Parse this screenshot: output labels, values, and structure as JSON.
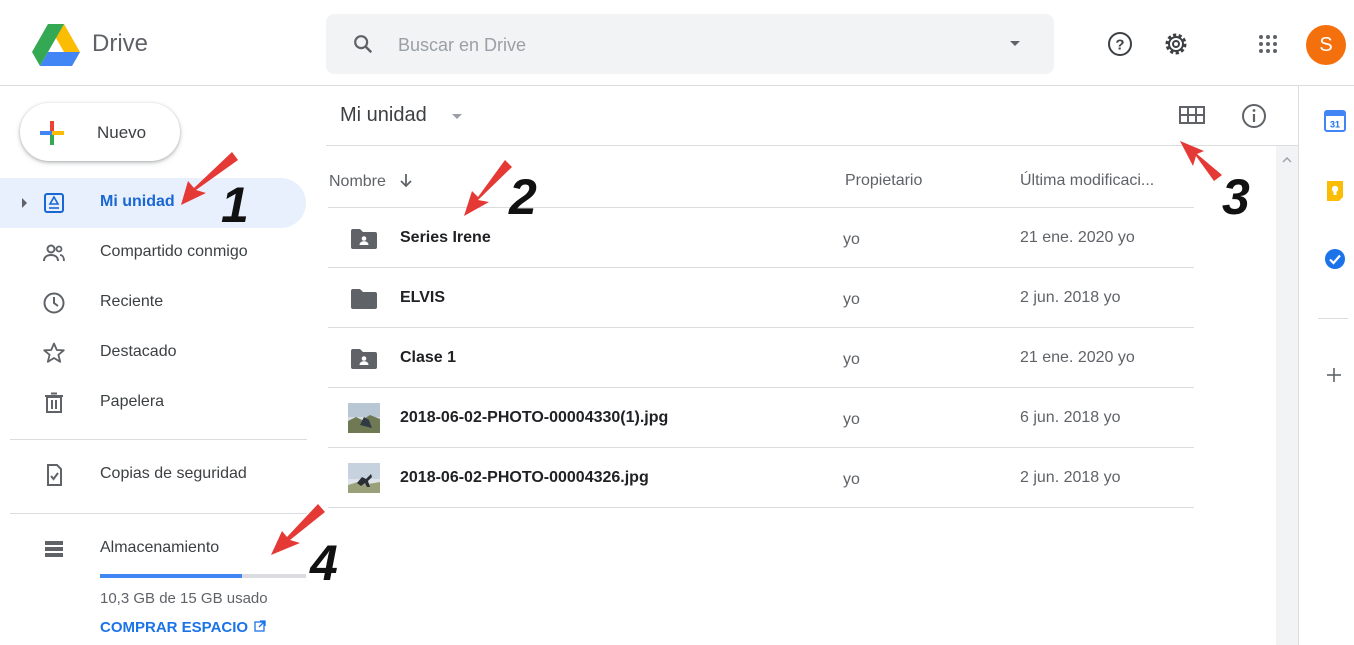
{
  "app": {
    "name": "Drive"
  },
  "search": {
    "placeholder": "Buscar en Drive"
  },
  "header": {
    "avatar_letter": "S",
    "avatar_color": "#f4700d",
    "icons": [
      "help-icon",
      "settings-icon",
      "apps-grid-icon"
    ]
  },
  "sidebar": {
    "new_label": "Nuevo",
    "items": [
      {
        "label": "Mi unidad",
        "icon": "my-drive-icon",
        "active": true
      },
      {
        "label": "Compartido conmigo",
        "icon": "shared-icon"
      },
      {
        "label": "Reciente",
        "icon": "clock-icon"
      },
      {
        "label": "Destacado",
        "icon": "star-icon"
      },
      {
        "label": "Papelera",
        "icon": "trash-icon"
      },
      {
        "label": "Copias de seguridad",
        "icon": "backup-icon"
      },
      {
        "label": "Almacenamiento",
        "icon": "storage-icon"
      }
    ],
    "storage": {
      "used_fraction": 0.687,
      "text": "10,3 GB de 15 GB usado",
      "buy_label": "COMPRAR ESPACIO"
    }
  },
  "main": {
    "breadcrumb": "Mi unidad",
    "columns": {
      "name": "Nombre",
      "owner": "Propietario",
      "modified": "Última modificaci..."
    },
    "files": [
      {
        "name": "Series Irene",
        "type": "shared-folder",
        "owner": "yo",
        "modified": "21 ene. 2020 yo"
      },
      {
        "name": "ELVIS",
        "type": "folder",
        "owner": "yo",
        "modified": "2 jun. 2018 yo"
      },
      {
        "name": "Clase 1",
        "type": "shared-folder",
        "owner": "yo",
        "modified": "21 ene. 2020 yo"
      },
      {
        "name": "2018-06-02-PHOTO-00004330(1).jpg",
        "type": "image",
        "owner": "yo",
        "modified": "6 jun. 2018 yo"
      },
      {
        "name": "2018-06-02-PHOTO-00004326.jpg",
        "type": "image",
        "owner": "yo",
        "modified": "2 jun. 2018 yo"
      }
    ]
  },
  "right_panel": {
    "icons": [
      "calendar-icon",
      "keep-icon",
      "tasks-icon",
      "add-addon-icon"
    ],
    "calendar_day": "31"
  },
  "annotations": [
    "1",
    "2",
    "3",
    "4"
  ],
  "colors": {
    "accent": "#1a73e8",
    "active_bg": "#e8f0fe",
    "arrow": "#e53935"
  }
}
